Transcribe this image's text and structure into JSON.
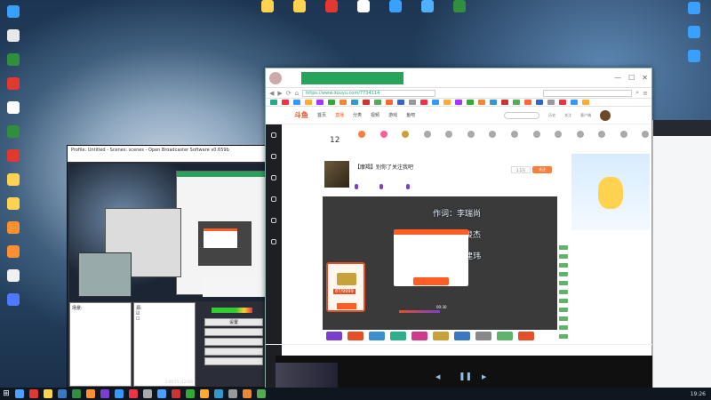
{
  "desktop_icons": [
    {
      "label": "",
      "color": "#3aa0ff"
    },
    {
      "label": "",
      "color": "#e8e8e8"
    },
    {
      "label": "",
      "color": "#2f8f3f"
    },
    {
      "label": "",
      "color": "#e3382f"
    },
    {
      "label": "",
      "color": "#ffffff"
    },
    {
      "label": "",
      "color": "#2f8f3f"
    },
    {
      "label": "",
      "color": "#e3382f"
    },
    {
      "label": "",
      "color": "#ffd34f"
    },
    {
      "label": "",
      "color": "#ffd34f"
    },
    {
      "label": "",
      "color": "#ff8f2f"
    },
    {
      "label": "",
      "color": "#ff8f2f"
    },
    {
      "label": "",
      "color": "#f0f0f0"
    },
    {
      "label": "",
      "color": "#4f78ff"
    }
  ],
  "top_icons": [
    {
      "label": "",
      "color": "#ffd34f"
    },
    {
      "label": "",
      "color": "#ffd34f"
    },
    {
      "label": "",
      "color": "#e3382f"
    },
    {
      "label": "",
      "color": "#ffffff"
    },
    {
      "label": "",
      "color": "#3aa0ff"
    },
    {
      "label": "",
      "color": "#4fb0ff"
    },
    {
      "label": "",
      "color": "#2f8f3f"
    }
  ],
  "right_icons": [
    {
      "label": "",
      "color": "#3aa0ff"
    },
    {
      "label": "",
      "color": "#3aa0ff"
    },
    {
      "label": "",
      "color": "#3aa0ff"
    }
  ],
  "obs": {
    "title": "Profile: Untitled - Scenes: scenes - Open Broadcaster Software v0.659b",
    "menu": [
      "",
      "",
      "",
      "",
      ""
    ],
    "panel_scenes_label": "场景:",
    "panel_sources_label": "源:",
    "scenes": [
      "",
      "",
      "",
      ""
    ],
    "sources": [
      "",
      ""
    ],
    "buttons": [
      "设置",
      "",
      "",
      "",
      ""
    ],
    "status_time": "0:00:15 (12/18)",
    "status_right": ""
  },
  "browser": {
    "tab_title": "",
    "url": "https://www.douyu.com/7734114",
    "search_placeholder": "",
    "logo": "斗鱼",
    "nav": [
      "首页",
      "直播",
      "分类",
      "视频",
      "游戏",
      "鱼吧"
    ],
    "site_search_placeholder": "",
    "nav_actions": [
      "历史",
      "关注",
      "客户端"
    ],
    "left_sidebar": [
      "",
      "",
      "",
      "",
      "",
      ""
    ],
    "level_number": "12",
    "gifts": [
      "",
      "",
      "",
      "",
      "",
      "",
      "",
      "",
      "",
      "",
      "",
      "",
      "",
      "",
      ""
    ],
    "room_title": "【摩羯】别你了关注我吧",
    "room_sub": "",
    "tags": [
      "",
      "",
      ""
    ],
    "follow_count": "1.1万",
    "follow_label": "关注",
    "lyrics": [
      "作词：李瑞尚",
      "作曲：林俊杰",
      "编曲：陈建玮"
    ],
    "lyrics_overlay": [
      "",
      "",
      ""
    ],
    "popup_title": "",
    "popup_body": "",
    "popup_button": "",
    "card_title": "",
    "card_value": "87/9999",
    "card_button": "",
    "player_time": "00:30",
    "chat": [
      {
        "badge": "",
        "name": "",
        "msg": ""
      },
      {
        "badge": "",
        "name": "",
        "msg": ""
      },
      {
        "badge": "",
        "name": "",
        "msg": ""
      },
      {
        "badge": "",
        "name": "",
        "msg": ""
      },
      {
        "badge": "",
        "name": "",
        "msg": ""
      },
      {
        "badge": "",
        "name": "",
        "msg": ""
      },
      {
        "badge": "",
        "name": "",
        "msg": ""
      },
      {
        "badge": "",
        "name": "",
        "msg": ""
      },
      {
        "badge": "",
        "name": "",
        "msg": ""
      },
      {
        "badge": "",
        "name": "",
        "msg": ""
      },
      {
        "badge": "",
        "name": "",
        "msg": ""
      }
    ],
    "bottom_bar": [
      "",
      "",
      "",
      ""
    ]
  },
  "video_panel": {
    "left_text": "",
    "left_sub": "",
    "right_text": "",
    "pause_glyph": "❚❚",
    "prev_glyph": "◀",
    "next_glyph": "▶"
  },
  "right_window": {
    "rows": [
      "",
      "",
      "",
      "",
      "",
      "",
      "",
      "",
      "",
      ""
    ]
  },
  "taskbar": {
    "start_glyph": "⊞",
    "clock": "19:26",
    "date": "",
    "tray_labels": [
      "",
      "",
      ""
    ]
  },
  "colors": {
    "accent": "#ff5d23",
    "obs_bg": "#2b2e38",
    "douyu_orange": "#e34f26",
    "tab_green": "#27a35a"
  }
}
